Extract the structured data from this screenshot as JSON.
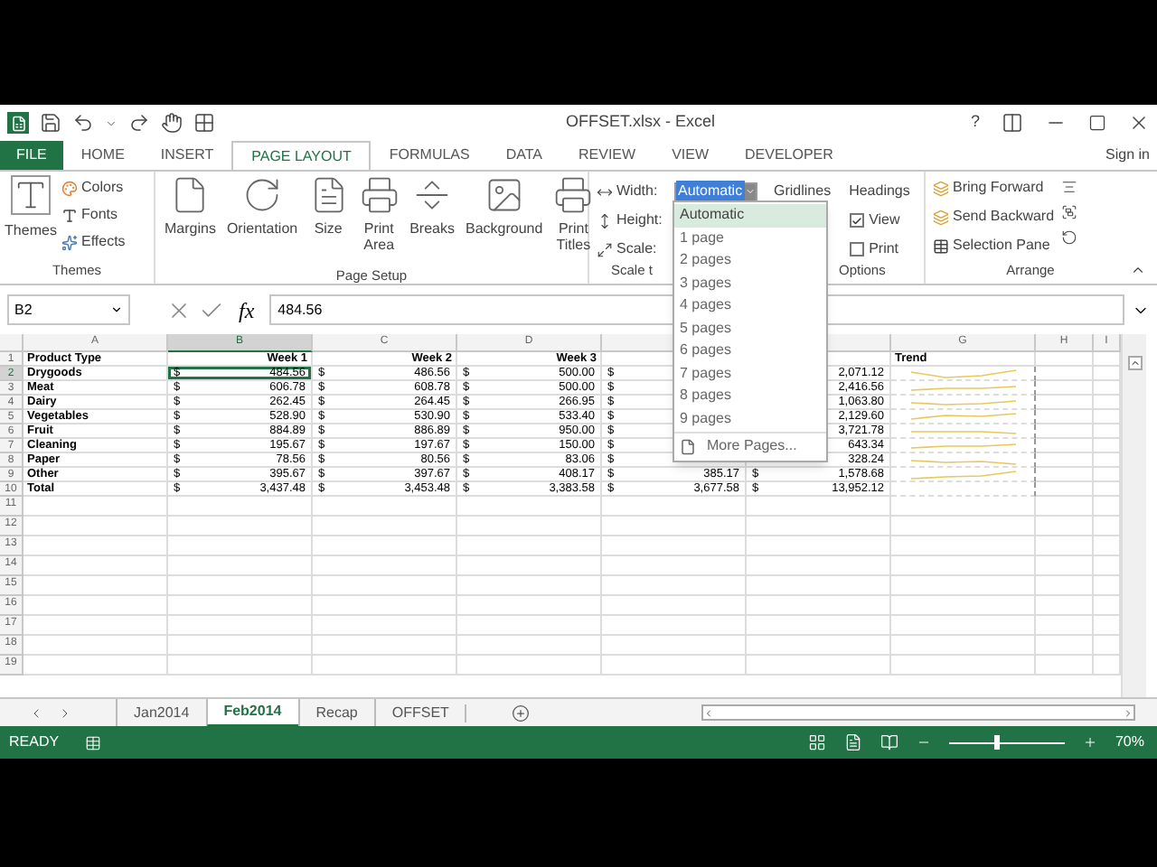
{
  "window": {
    "title": "OFFSET.xlsx - Excel",
    "help": "?"
  },
  "ribbon_tabs": [
    {
      "label": "FILE",
      "kind": "file",
      "selected": false
    },
    {
      "label": "HOME",
      "kind": "tab",
      "selected": false
    },
    {
      "label": "INSERT",
      "kind": "tab",
      "selected": false
    },
    {
      "label": "PAGE LAYOUT",
      "kind": "tab",
      "selected": true
    },
    {
      "label": "FORMULAS",
      "kind": "tab",
      "selected": false
    },
    {
      "label": "DATA",
      "kind": "tab",
      "selected": false
    },
    {
      "label": "REVIEW",
      "kind": "tab",
      "selected": false
    },
    {
      "label": "VIEW",
      "kind": "tab",
      "selected": false
    },
    {
      "label": "DEVELOPER",
      "kind": "tab",
      "selected": false
    }
  ],
  "account": "Sign in",
  "themes_group": {
    "label": "Themes",
    "themes": "Themes",
    "colors": "Colors",
    "fonts": "Fonts",
    "effects": "Effects"
  },
  "page_setup_group": {
    "label": "Page Setup",
    "buttons": [
      {
        "label": "Margins",
        "kind": "margins"
      },
      {
        "label": "Orientation",
        "kind": "orientation"
      },
      {
        "label": "Size",
        "kind": "size"
      },
      {
        "label": "Print Area",
        "kind": "print"
      },
      {
        "label": "Breaks",
        "kind": "breaks"
      },
      {
        "label": "Background",
        "kind": "background"
      },
      {
        "label": "Print Titles",
        "kind": "print"
      }
    ]
  },
  "scale_group": {
    "label": "Scale t",
    "width_label": "Width:",
    "width_value": "Automatic",
    "height_label": "Height:",
    "scale_label": "Scale:"
  },
  "sheet_options_group": {
    "label": "Options",
    "gridlines": "Gridlines",
    "headings": "Headings",
    "view": "View",
    "view_checked": true,
    "print": "Print",
    "print_checked": false
  },
  "arrange_group": {
    "label": "Arrange",
    "bring_forward": "Bring Forward",
    "send_backward": "Send Backward",
    "selection_pane": "Selection Pane"
  },
  "width_menu": {
    "items": [
      {
        "label": "Automatic",
        "selected": true
      },
      {
        "label": "1 page",
        "selected": false
      },
      {
        "label": "2 pages",
        "selected": false
      },
      {
        "label": "3 pages",
        "selected": false
      },
      {
        "label": "4 pages",
        "selected": false
      },
      {
        "label": "5 pages",
        "selected": false
      },
      {
        "label": "6 pages",
        "selected": false
      },
      {
        "label": "7 pages",
        "selected": false
      },
      {
        "label": "8 pages",
        "selected": false
      },
      {
        "label": "9 pages",
        "selected": false
      }
    ],
    "more": "More Pages..."
  },
  "name_box": "B2",
  "function_label": "fx",
  "formula": "484.56",
  "columns": [
    {
      "header": "A",
      "selected": false
    },
    {
      "header": "B",
      "selected": true
    },
    {
      "header": "C",
      "selected": false
    },
    {
      "header": "D",
      "selected": false
    },
    {
      "selected": false
    },
    {
      "selected": false
    },
    {
      "header": "G",
      "selected": false
    },
    {
      "header": "H",
      "selected": false
    },
    {
      "header": "I",
      "selected": false
    }
  ],
  "rows": [
    {
      "number": "1",
      "kind": "header",
      "selected": false,
      "label": "Product Type",
      "headings": [
        "Week 1",
        "Week 2",
        "Week 3"
      ],
      "trend_heading": "Trend"
    },
    {
      "number": "2",
      "kind": "data",
      "selected": true,
      "label": "Drygoods",
      "amounts": [
        {
          "symbol": "$",
          "value": "484.56"
        },
        {
          "symbol": "$",
          "value": "486.56"
        },
        {
          "symbol": "$",
          "value": "500.00"
        },
        {
          "symbol": "$"
        },
        {
          "value": "2,071.12"
        }
      ]
    },
    {
      "number": "3",
      "kind": "data",
      "selected": false,
      "label": "Meat",
      "amounts": [
        {
          "symbol": "$",
          "value": "606.78"
        },
        {
          "symbol": "$",
          "value": "608.78"
        },
        {
          "symbol": "$",
          "value": "500.00"
        },
        {
          "symbol": "$"
        },
        {
          "value": "2,416.56"
        }
      ]
    },
    {
      "number": "4",
      "kind": "data",
      "selected": false,
      "label": "Dairy",
      "amounts": [
        {
          "symbol": "$",
          "value": "262.45"
        },
        {
          "symbol": "$",
          "value": "264.45"
        },
        {
          "symbol": "$",
          "value": "266.95"
        },
        {
          "symbol": "$"
        },
        {
          "value": "1,063.80"
        }
      ]
    },
    {
      "number": "5",
      "kind": "data",
      "selected": false,
      "label": "Vegetables",
      "amounts": [
        {
          "symbol": "$",
          "value": "528.90"
        },
        {
          "symbol": "$",
          "value": "530.90"
        },
        {
          "symbol": "$",
          "value": "533.40"
        },
        {
          "symbol": "$"
        },
        {
          "value": "2,129.60"
        }
      ]
    },
    {
      "number": "6",
      "kind": "data",
      "selected": false,
      "label": "Fruit",
      "amounts": [
        {
          "symbol": "$",
          "value": "884.89"
        },
        {
          "symbol": "$",
          "value": "886.89"
        },
        {
          "symbol": "$",
          "value": "950.00"
        },
        {
          "symbol": "$"
        },
        {
          "value": "3,721.78"
        }
      ]
    },
    {
      "number": "7",
      "kind": "data",
      "selected": false,
      "label": "Cleaning",
      "amounts": [
        {
          "symbol": "$",
          "value": "195.67"
        },
        {
          "symbol": "$",
          "value": "197.67"
        },
        {
          "symbol": "$",
          "value": "150.00"
        },
        {
          "symbol": "$"
        },
        {
          "value": "643.34"
        }
      ]
    },
    {
      "number": "8",
      "kind": "data",
      "selected": false,
      "label": "Paper",
      "amounts": [
        {
          "symbol": "$",
          "value": "78.56"
        },
        {
          "symbol": "$",
          "value": "80.56"
        },
        {
          "symbol": "$",
          "value": "83.06"
        },
        {
          "symbol": "$"
        },
        {
          "value": "328.24"
        }
      ]
    },
    {
      "number": "9",
      "kind": "data",
      "selected": false,
      "label": "Other",
      "amounts": [
        {
          "symbol": "$",
          "value": "395.67"
        },
        {
          "symbol": "$",
          "value": "397.67"
        },
        {
          "symbol": "$",
          "value": "408.17"
        },
        {
          "symbol": "$",
          "value": "385.17"
        },
        {
          "symbol": "$",
          "value": "1,578.68"
        }
      ]
    },
    {
      "number": "10",
      "kind": "total",
      "selected": false,
      "label": "Total",
      "amounts": [
        {
          "symbol": "$",
          "value": "3,437.48"
        },
        {
          "symbol": "$",
          "value": "3,453.48"
        },
        {
          "symbol": "$",
          "value": "3,383.58"
        },
        {
          "symbol": "$",
          "value": "3,677.58"
        },
        {
          "symbol": "$",
          "value": "13,952.12"
        }
      ]
    },
    {
      "number": "11",
      "kind": "empty",
      "selected": false
    },
    {
      "number": "12",
      "kind": "empty",
      "selected": false
    },
    {
      "number": "13",
      "kind": "empty",
      "selected": false
    },
    {
      "number": "14",
      "kind": "empty",
      "selected": false
    },
    {
      "number": "15",
      "kind": "empty",
      "selected": false
    },
    {
      "number": "16",
      "kind": "empty",
      "selected": false
    },
    {
      "number": "17",
      "kind": "empty",
      "selected": false
    },
    {
      "number": "18",
      "kind": "empty",
      "selected": false
    },
    {
      "number": "19",
      "kind": "empty",
      "selected": false
    }
  ],
  "sheet_tabs": [
    {
      "label": "Jan2014",
      "selected": false
    },
    {
      "label": "Feb2014",
      "selected": true
    },
    {
      "label": "Recap",
      "selected": false
    },
    {
      "label": "OFFSET",
      "selected": false
    }
  ],
  "status_bar": {
    "mode": "READY",
    "level": 0.4,
    "zoom": "70%"
  }
}
